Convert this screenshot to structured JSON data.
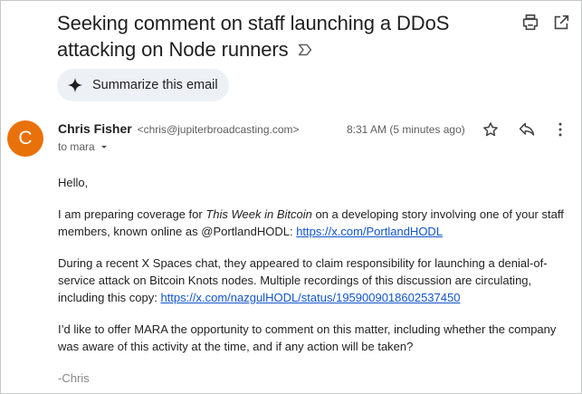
{
  "email": {
    "subject": "Seeking comment on staff launching a DDoS attacking on Node runners",
    "summarize_label": "Summarize this email",
    "sender_name": "Chris Fisher",
    "sender_email": "<chris@jupiterbroadcasting.com>",
    "to_label": "to mara",
    "time": "8:31 AM (5 minutes ago)",
    "body": {
      "greeting": "Hello,",
      "p1_pre": "I am preparing coverage for ",
      "p1_italic": "This Week in Bitcoin",
      "p1_post": " on a developing story involving one of your staff members, known online as @PortlandHODL: ",
      "p1_link": "https://x.com/PortlandHODL",
      "p2_text": "During a recent X Spaces chat, they appeared to claim responsibility for launching a denial-of-service attack on Bitcoin Knots nodes. Multiple recordings of this discussion are circulating, including this copy: ",
      "p2_link": "https://x.com/nazgulHODL/status/1959009018602537450",
      "p3": "I’d like to offer MARA the opportunity to comment on this matter, including whether the company was aware of this activity at the time, and if any action will be taken?",
      "signature": "-Chris"
    },
    "avatar_letter": "C"
  },
  "icons": [
    "print-icon",
    "open-in-new-window-icon",
    "label-icon",
    "sparkle-icon",
    "star-icon",
    "reply-icon",
    "more-vert-icon",
    "dropdown-icon"
  ],
  "colors": {
    "avatar": "#e8710a",
    "link": "#1155cc",
    "summarize_bg": "#edf1f6"
  }
}
